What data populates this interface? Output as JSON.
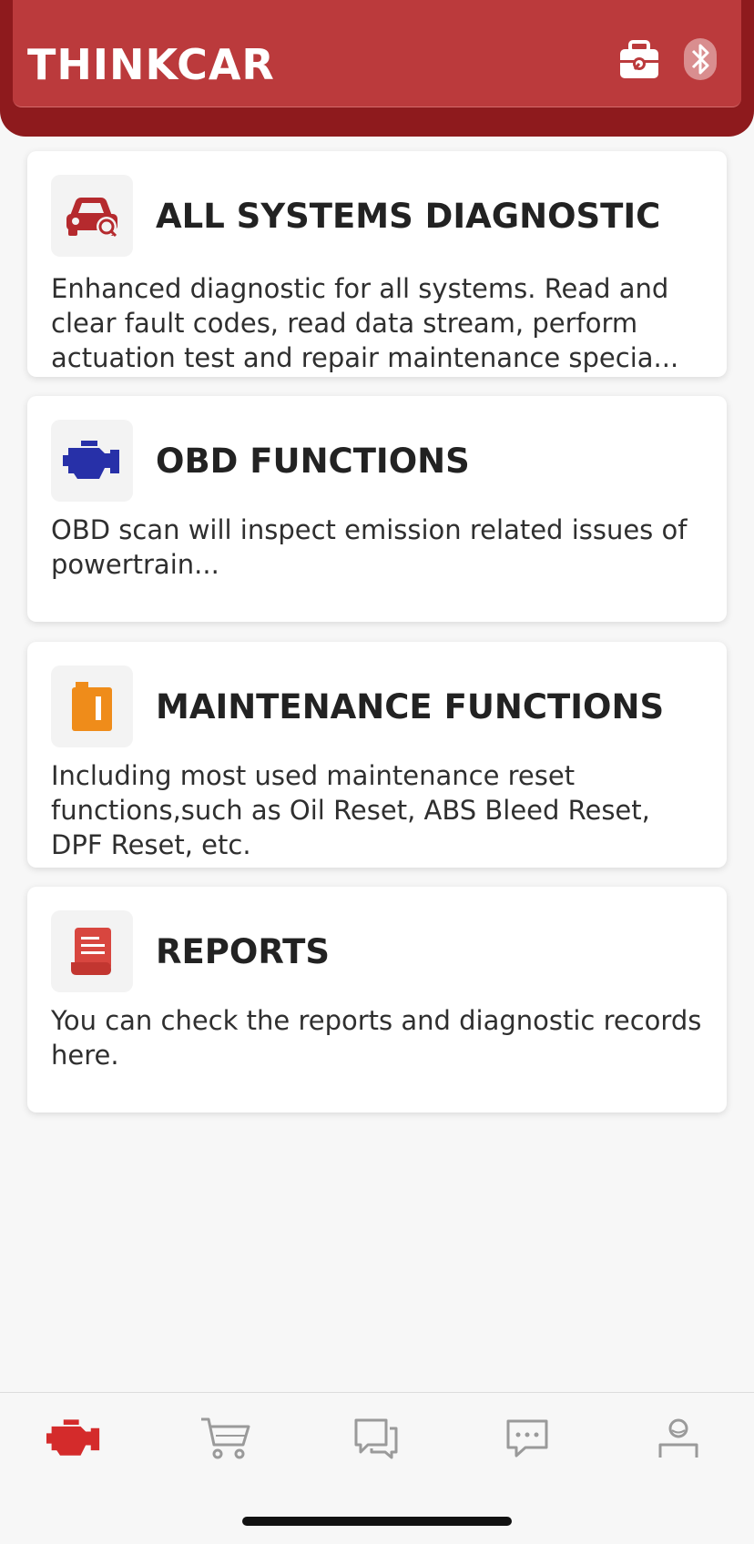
{
  "header": {
    "brand": "THINKCAR",
    "icons": [
      "toolbox-icon",
      "bluetooth-icon"
    ],
    "colors": {
      "primary": "#bb3a3c",
      "dark": "#8e1a1d"
    }
  },
  "cards": [
    {
      "icon": "car-diagnostic-icon",
      "title": "ALL SYSTEMS DIAGNOSTIC",
      "description": "Enhanced diagnostic for all systems. Read and clear fault codes, read data stream, perform actuation test and repair maintenance specia..."
    },
    {
      "icon": "engine-icon",
      "title": "OBD FUNCTIONS",
      "description": "OBD scan will inspect emission related issues of powertrain..."
    },
    {
      "icon": "oil-can-icon",
      "title": "MAINTENANCE FUNCTIONS",
      "description": "Including most used maintenance reset functions,such as Oil Reset, ABS Bleed Reset, DPF Reset, etc."
    },
    {
      "icon": "report-icon",
      "title": "REPORTS",
      "description": "You can check the reports and diagnostic records here."
    }
  ],
  "bottom_nav": {
    "items": [
      "engine-icon",
      "cart-icon",
      "chat-icon",
      "message-icon",
      "profile-icon"
    ],
    "active": "engine-icon",
    "active_color": "#d42b2b",
    "inactive_color": "#9a9a9a"
  }
}
